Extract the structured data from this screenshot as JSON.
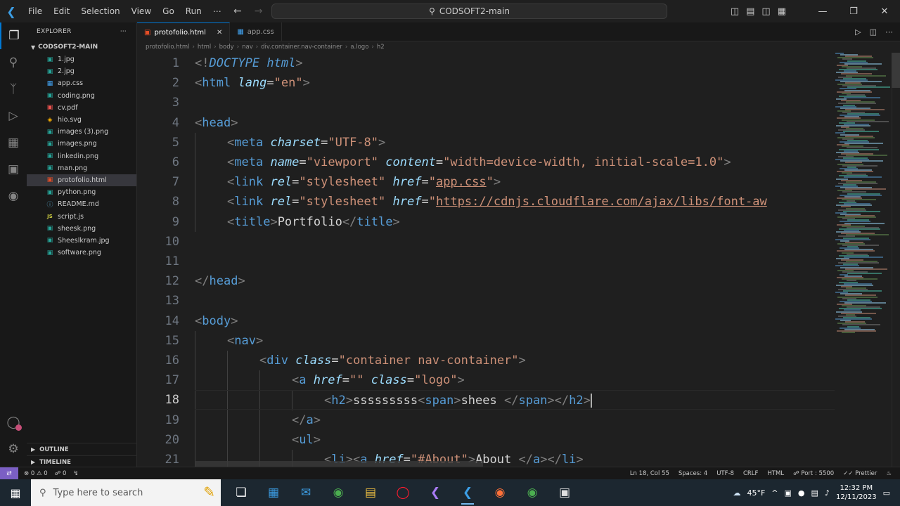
{
  "titlebar": {
    "menu": [
      "File",
      "Edit",
      "Selection",
      "View",
      "Go",
      "Run",
      "⋯"
    ],
    "search_text": "CODSOFT2-main"
  },
  "sidebar": {
    "explorer_title": "EXPLORER",
    "folder": "CODSOFT2-MAIN",
    "files": [
      {
        "name": "1.jpg",
        "type": "img"
      },
      {
        "name": "2.jpg",
        "type": "img"
      },
      {
        "name": "app.css",
        "type": "css"
      },
      {
        "name": "coding.png",
        "type": "img"
      },
      {
        "name": "cv.pdf",
        "type": "pdf"
      },
      {
        "name": "hio.svg",
        "type": "svg"
      },
      {
        "name": "images (3).png",
        "type": "img"
      },
      {
        "name": "images.png",
        "type": "img"
      },
      {
        "name": "linkedin.png",
        "type": "img"
      },
      {
        "name": "man.png",
        "type": "img"
      },
      {
        "name": "protofolio.html",
        "type": "html",
        "selected": true
      },
      {
        "name": "python.png",
        "type": "img"
      },
      {
        "name": "README.md",
        "type": "md"
      },
      {
        "name": "script.js",
        "type": "js"
      },
      {
        "name": "sheesk.png",
        "type": "img"
      },
      {
        "name": "Sheeslkram.jpg",
        "type": "img"
      },
      {
        "name": "software.png",
        "type": "img"
      }
    ],
    "outline": "OUTLINE",
    "timeline": "TIMELINE"
  },
  "tabs": [
    {
      "label": "protofolio.html",
      "active": true
    },
    {
      "label": "app.css",
      "active": false
    }
  ],
  "breadcrumbs": [
    "protofolio.html",
    "html",
    "body",
    "nav",
    "div.container.nav-container",
    "a.logo",
    "h2"
  ],
  "editor": {
    "current_line": 18,
    "lines": [
      {
        "n": 1,
        "indent": 0,
        "tokens": [
          [
            "punc",
            "<!"
          ],
          [
            "doctype",
            "DOCTYPE"
          ],
          [
            "text",
            " "
          ],
          [
            "doctype",
            "html"
          ],
          [
            "punc",
            ">"
          ]
        ]
      },
      {
        "n": 2,
        "indent": 0,
        "tokens": [
          [
            "punc",
            "<"
          ],
          [
            "tag",
            "html"
          ],
          [
            "text",
            " "
          ],
          [
            "attr",
            "lang"
          ],
          [
            "text",
            "="
          ],
          [
            "str",
            "\"en\""
          ],
          [
            "punc",
            ">"
          ]
        ]
      },
      {
        "n": 3,
        "indent": 0,
        "tokens": []
      },
      {
        "n": 4,
        "indent": 0,
        "tokens": [
          [
            "punc",
            "<"
          ],
          [
            "tag",
            "head"
          ],
          [
            "punc",
            ">"
          ]
        ]
      },
      {
        "n": 5,
        "indent": 1,
        "tokens": [
          [
            "punc",
            "<"
          ],
          [
            "tag",
            "meta"
          ],
          [
            "text",
            " "
          ],
          [
            "attr",
            "charset"
          ],
          [
            "text",
            "="
          ],
          [
            "str",
            "\"UTF-8\""
          ],
          [
            "punc",
            ">"
          ]
        ]
      },
      {
        "n": 6,
        "indent": 1,
        "tokens": [
          [
            "punc",
            "<"
          ],
          [
            "tag",
            "meta"
          ],
          [
            "text",
            " "
          ],
          [
            "attr",
            "name"
          ],
          [
            "text",
            "="
          ],
          [
            "str",
            "\"viewport\""
          ],
          [
            "text",
            " "
          ],
          [
            "attr",
            "content"
          ],
          [
            "text",
            "="
          ],
          [
            "str",
            "\"width=device-width, initial-scale=1.0\""
          ],
          [
            "punc",
            ">"
          ]
        ]
      },
      {
        "n": 7,
        "indent": 1,
        "tokens": [
          [
            "punc",
            "<"
          ],
          [
            "tag",
            "link"
          ],
          [
            "text",
            " "
          ],
          [
            "attr",
            "rel"
          ],
          [
            "text",
            "="
          ],
          [
            "str",
            "\"stylesheet\""
          ],
          [
            "text",
            " "
          ],
          [
            "attr",
            "href"
          ],
          [
            "text",
            "="
          ],
          [
            "str",
            "\""
          ],
          [
            "link",
            "app.css"
          ],
          [
            "str",
            "\""
          ],
          [
            "punc",
            ">"
          ]
        ]
      },
      {
        "n": 8,
        "indent": 1,
        "tokens": [
          [
            "punc",
            "<"
          ],
          [
            "tag",
            "link"
          ],
          [
            "text",
            " "
          ],
          [
            "attr",
            "rel"
          ],
          [
            "text",
            "="
          ],
          [
            "str",
            "\"stylesheet\""
          ],
          [
            "text",
            " "
          ],
          [
            "attr",
            "href"
          ],
          [
            "text",
            "="
          ],
          [
            "str",
            "\""
          ],
          [
            "link",
            "https://cdnjs.cloudflare.com/ajax/libs/font-aw"
          ]
        ]
      },
      {
        "n": 9,
        "indent": 1,
        "tokens": [
          [
            "punc",
            "<"
          ],
          [
            "tag",
            "title"
          ],
          [
            "punc",
            ">"
          ],
          [
            "text",
            "Portfolio"
          ],
          [
            "punc",
            "</"
          ],
          [
            "tag",
            "title"
          ],
          [
            "punc",
            ">"
          ]
        ]
      },
      {
        "n": 10,
        "indent": 0,
        "tokens": []
      },
      {
        "n": 11,
        "indent": 0,
        "tokens": []
      },
      {
        "n": 12,
        "indent": 0,
        "tokens": [
          [
            "punc",
            "</"
          ],
          [
            "tag",
            "head"
          ],
          [
            "punc",
            ">"
          ]
        ]
      },
      {
        "n": 13,
        "indent": 0,
        "tokens": []
      },
      {
        "n": 14,
        "indent": 0,
        "tokens": [
          [
            "punc",
            "<"
          ],
          [
            "tag",
            "body"
          ],
          [
            "punc",
            ">"
          ]
        ]
      },
      {
        "n": 15,
        "indent": 1,
        "tokens": [
          [
            "punc",
            "<"
          ],
          [
            "tag",
            "nav"
          ],
          [
            "punc",
            ">"
          ]
        ]
      },
      {
        "n": 16,
        "indent": 2,
        "tokens": [
          [
            "punc",
            "<"
          ],
          [
            "tag",
            "div"
          ],
          [
            "text",
            " "
          ],
          [
            "attr",
            "class"
          ],
          [
            "text",
            "="
          ],
          [
            "str",
            "\"container nav-container\""
          ],
          [
            "punc",
            ">"
          ]
        ]
      },
      {
        "n": 17,
        "indent": 3,
        "tokens": [
          [
            "punc",
            "<"
          ],
          [
            "tag",
            "a"
          ],
          [
            "text",
            " "
          ],
          [
            "attr",
            "href"
          ],
          [
            "text",
            "="
          ],
          [
            "str",
            "\"\""
          ],
          [
            "text",
            " "
          ],
          [
            "attr",
            "class"
          ],
          [
            "text",
            "="
          ],
          [
            "str",
            "\"logo\""
          ],
          [
            "punc",
            ">"
          ]
        ]
      },
      {
        "n": 18,
        "indent": 4,
        "tokens": [
          [
            "punc",
            "<"
          ],
          [
            "tag",
            "h2"
          ],
          [
            "punc",
            ">"
          ],
          [
            "text",
            "sssssssss"
          ],
          [
            "punc",
            "<"
          ],
          [
            "tag",
            "span"
          ],
          [
            "punc",
            ">"
          ],
          [
            "text",
            "shees "
          ],
          [
            "punc",
            "</"
          ],
          [
            "tag",
            "span"
          ],
          [
            "punc",
            "></"
          ],
          [
            "tag",
            "h2"
          ],
          [
            "punc",
            ">"
          ]
        ]
      },
      {
        "n": 19,
        "indent": 3,
        "tokens": [
          [
            "punc",
            "</"
          ],
          [
            "tag",
            "a"
          ],
          [
            "punc",
            ">"
          ]
        ]
      },
      {
        "n": 20,
        "indent": 3,
        "tokens": [
          [
            "punc",
            "<"
          ],
          [
            "tag",
            "ul"
          ],
          [
            "punc",
            ">"
          ]
        ]
      },
      {
        "n": 21,
        "indent": 4,
        "tokens": [
          [
            "punc",
            "<"
          ],
          [
            "tag",
            "li"
          ],
          [
            "punc",
            "><"
          ],
          [
            "tag",
            "a"
          ],
          [
            "text",
            " "
          ],
          [
            "attr",
            "href"
          ],
          [
            "text",
            "="
          ],
          [
            "str",
            "\"#About\""
          ],
          [
            "punc",
            ">"
          ],
          [
            "text",
            "About "
          ],
          [
            "punc",
            "</"
          ],
          [
            "tag",
            "a"
          ],
          [
            "punc",
            "></"
          ],
          [
            "tag",
            "li"
          ],
          [
            "punc",
            ">"
          ]
        ]
      }
    ]
  },
  "statusbar": {
    "errors": "0",
    "warnings": "0",
    "ports": "0",
    "position": "Ln 18, Col 55",
    "spaces": "Spaces: 4",
    "encoding": "UTF-8",
    "eol": "CRLF",
    "language": "HTML",
    "port": "Port : 5500",
    "formatter": "Prettier"
  },
  "taskbar": {
    "search_placeholder": "Type here to search",
    "weather": "45°F",
    "time": "12:32 PM",
    "date": "12/11/2023"
  }
}
